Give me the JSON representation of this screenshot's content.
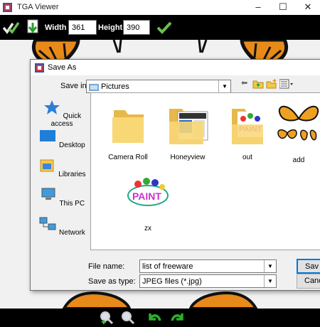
{
  "app": {
    "title": "TGA Viewer",
    "controls": {
      "minimize": "–",
      "maximize": "☐",
      "close": "✕"
    }
  },
  "toolbar": {
    "width_label": "Width",
    "width_value": "361",
    "height_label": "Height",
    "height_value": "390"
  },
  "dialog": {
    "title": "Save As",
    "save_in_label": "Save in:",
    "save_in_value": "Pictures",
    "places": [
      {
        "label": "Quick access",
        "icon": "star-icon"
      },
      {
        "label": "Desktop",
        "icon": "desktop-icon"
      },
      {
        "label": "Libraries",
        "icon": "libraries-icon"
      },
      {
        "label": "This PC",
        "icon": "computer-icon"
      },
      {
        "label": "Network",
        "icon": "network-icon"
      }
    ],
    "files": [
      {
        "name": "Camera Roll",
        "kind": "folder"
      },
      {
        "name": "Honeyview",
        "kind": "folder-app"
      },
      {
        "name": "out",
        "kind": "folder-paint"
      },
      {
        "name": "add",
        "kind": "image-butterflies"
      },
      {
        "name": "zx",
        "kind": "image-paint"
      }
    ],
    "file_name_label": "File name:",
    "file_name_value": "list of freeware",
    "save_type_label": "Save as type:",
    "save_type_value": "JPEG files (*.jpg)",
    "save_button": "Sav",
    "cancel_button": "Cance",
    "paint_text": "PAINT"
  }
}
